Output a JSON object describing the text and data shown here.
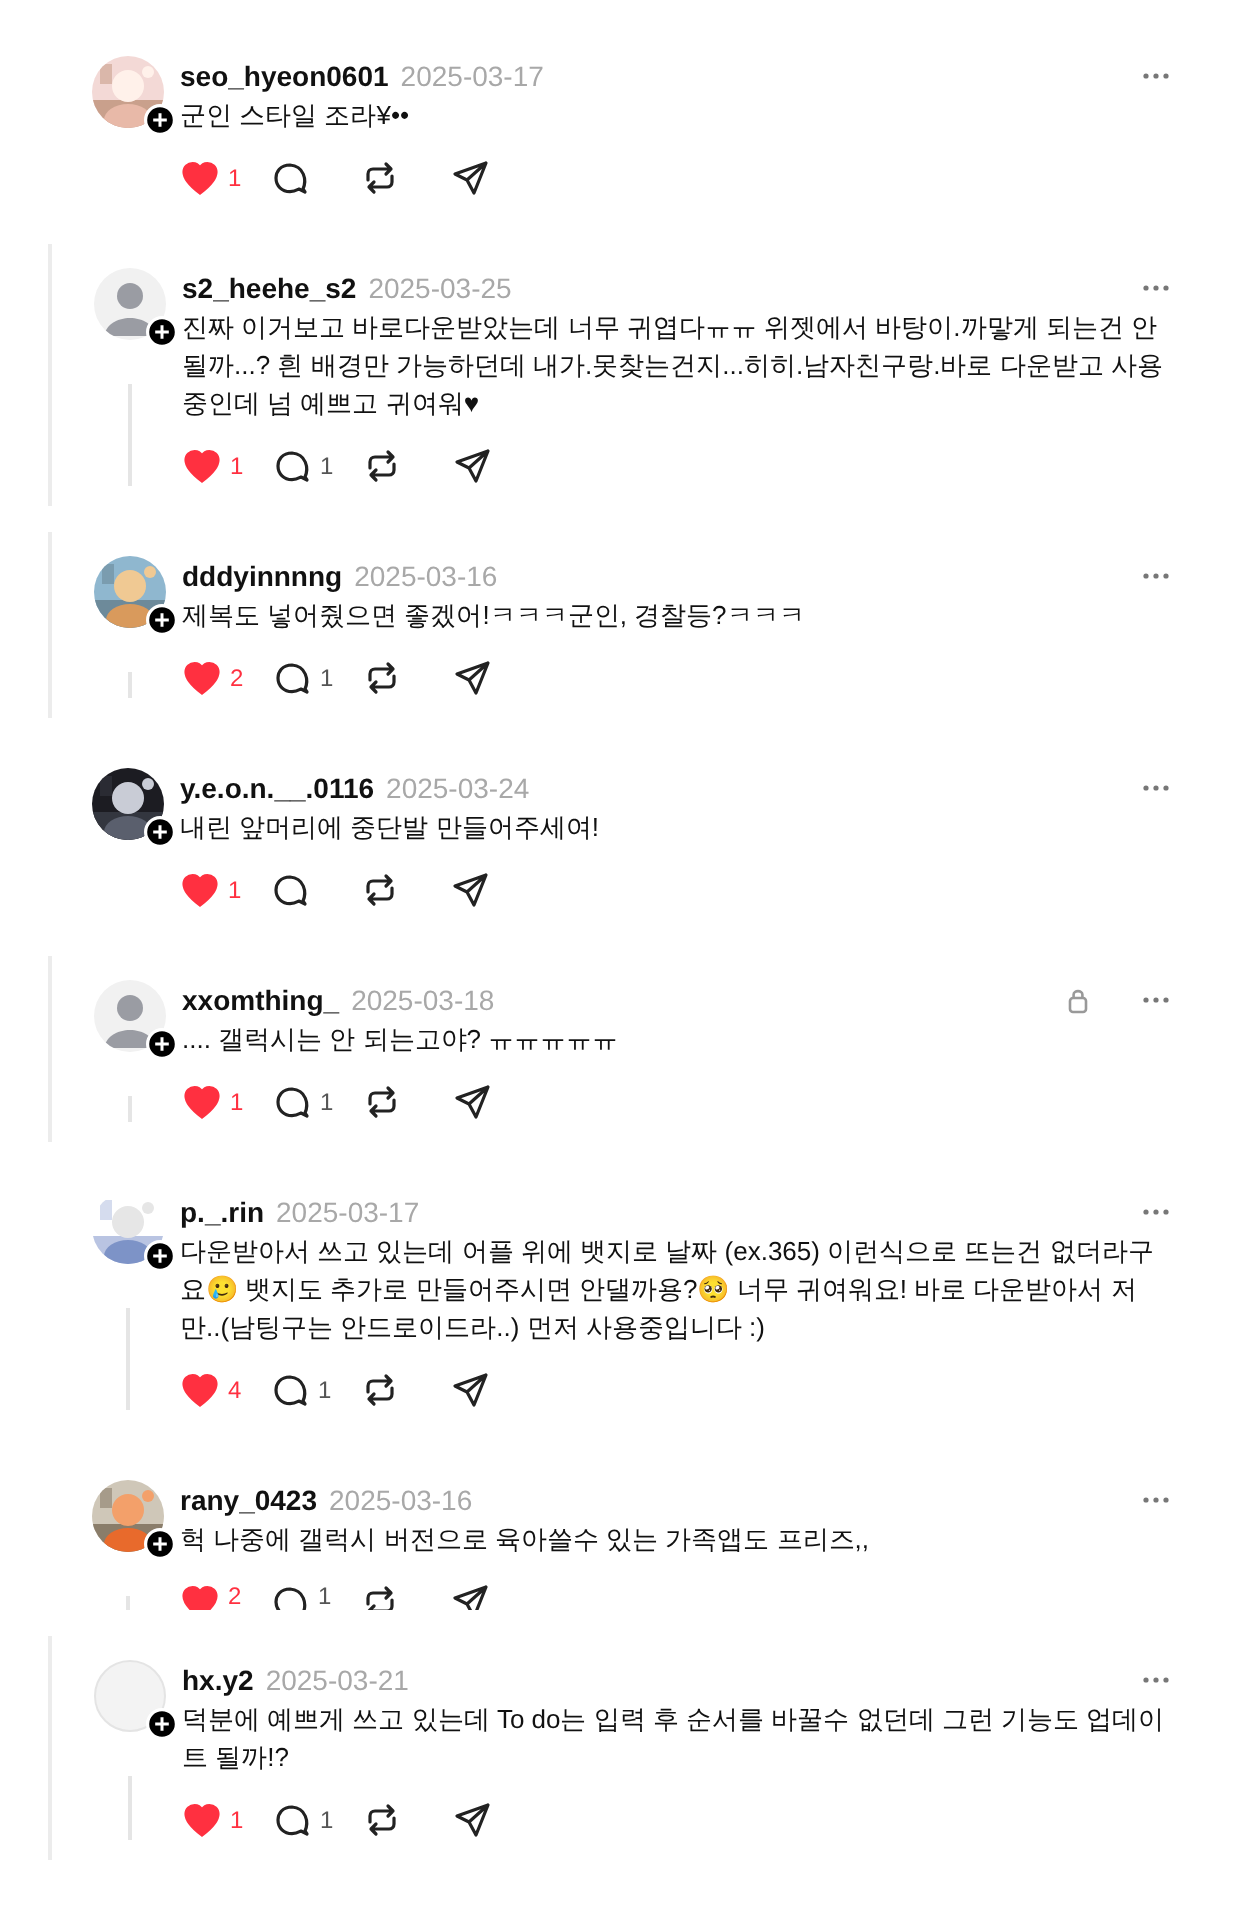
{
  "posts": [
    {
      "username": "seo_hyeon0601",
      "date": "2025-03-17",
      "text": "군인 스타일 조라¥••",
      "boxed": false,
      "thread_line": false,
      "liked": true,
      "likes": "1"
    },
    {
      "username": "s2_heehe_s2",
      "date": "2025-03-25",
      "text": "진짜 이거보고 바로다운받았는데 너무 귀엽다ㅠㅠ 위젯에서 바탕이.까맣게 되는건 안될까...? 흰 배경만 가능하던데 내가.못찾는건지...히히.남자친구랑.바로 다운받고 사용중인데 넘 예쁘고 귀여워♥",
      "avatar": {
        "kind": "default"
      },
      "boxed": true,
      "thread_line": true,
      "liked": true,
      "likes": "1",
      "replies": "1"
    },
    {
      "username": "dddyinnnng",
      "date": "2025-03-16",
      "text": "제복도 넣어줬으면 좋겠어!ㅋㅋㅋ군인, 경찰등?ㅋㅋㅋ",
      "boxed": true,
      "thread_line": true,
      "liked": true,
      "likes": "2",
      "replies": "1"
    },
    {
      "username": "y.e.o.n.__.0116",
      "date": "2025-03-24",
      "text": "내린 앞머리에 중단발 만들어주세여!",
      "boxed": false,
      "thread_line": false,
      "liked": true,
      "likes": "1"
    },
    {
      "username": "xxomthing_",
      "date": "2025-03-18",
      "text": ".... 갤럭시는 안 되는고야? ㅠㅠㅠㅠㅠ",
      "avatar": {
        "kind": "default"
      },
      "boxed": true,
      "thread_line": true,
      "locked": true,
      "liked": true,
      "likes": "1",
      "replies": "1"
    },
    {
      "username": "p._.rin",
      "date": "2025-03-17",
      "text": "다운받아서 쓰고 있는데 어플 위에 뱃지로 날짜 (ex.365) 이런식으로 뜨는건 없더라구요🥲 뱃지도 추가로 만들어주시면 안댈까용?🥺 너무 귀여워요! 바로 다운받아서 저만..(남팅구는 안드로이드라..) 먼저 사용중입니다 :)",
      "boxed": false,
      "thread_line": true,
      "liked": true,
      "likes": "4",
      "replies": "1"
    },
    {
      "username": "rany_0423",
      "date": "2025-03-16",
      "text": "헉 나중에 갤럭시 버전으로 육아쓸수 있는 가족앱도 프리즈,,",
      "boxed": false,
      "thread_line": true,
      "liked": true,
      "likes": "2",
      "replies": "1",
      "clipped": true
    },
    {
      "username": "hx.y2",
      "date": "2025-03-21",
      "text": "덕분에 예쁘게 쓰고 있는데 To do는 입력 후 순서를 바꿀수 없던데 그런 기능도 업데이트 될까!?",
      "avatar": {
        "kind": "blank"
      },
      "boxed": true,
      "thread_line": true,
      "liked": true,
      "likes": "1",
      "replies": "1"
    }
  ]
}
